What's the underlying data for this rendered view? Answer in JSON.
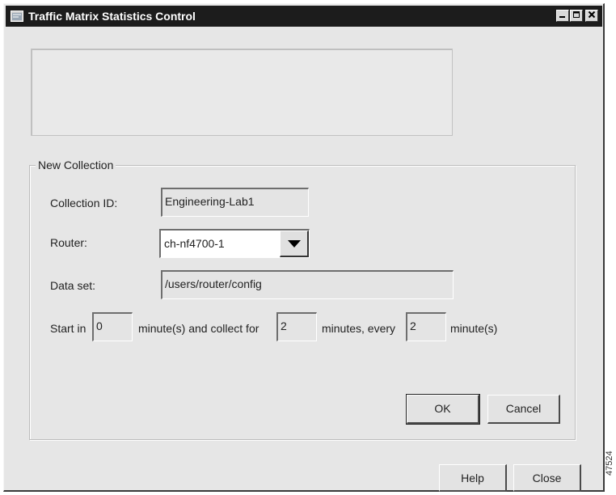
{
  "window": {
    "title": "Traffic Matrix Statistics Control",
    "icon": "app-window-icon",
    "controls": {
      "minimize_icon": "minimize-icon",
      "maximize_icon": "maximize-icon",
      "close_icon": "close-icon"
    }
  },
  "group": {
    "legend": "New Collection"
  },
  "form": {
    "collection_id_label": "Collection ID:",
    "collection_id_value": "Engineering-Lab1",
    "router_label": "Router:",
    "router_value": "ch-nf4700-1",
    "dataset_label": "Data set:",
    "dataset_value": "/users/router/config",
    "start_in_label": "Start in",
    "start_in_value": "0",
    "collect_for_label": "minute(s) and collect for",
    "collect_for_value": "2",
    "every_label": "minutes, every",
    "every_value": "2",
    "every_unit_label": "minute(s)"
  },
  "buttons": {
    "ok": "OK",
    "cancel": "Cancel",
    "help": "Help",
    "close": "Close"
  },
  "figure_id": "47524",
  "colors": {
    "titlebar": "#1c1c1c",
    "window_bg": "#e6e6e6"
  }
}
